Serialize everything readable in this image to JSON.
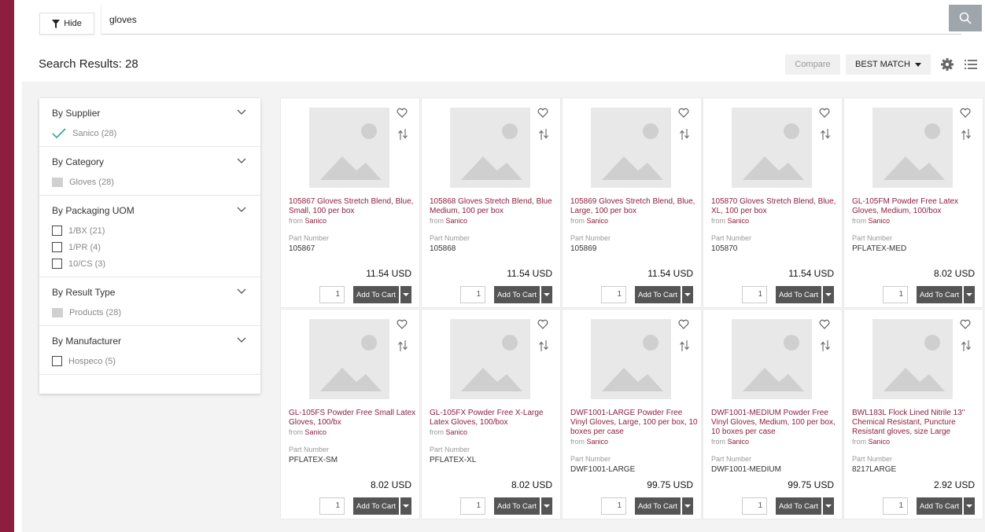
{
  "search": {
    "hide_label": "Hide",
    "value": "gloves"
  },
  "results": {
    "title": "Search Results: 28",
    "compare_label": "Compare",
    "sort_label": "BEST MATCH"
  },
  "filters": [
    {
      "title": "By Supplier",
      "options": [
        {
          "label": "Sanico (28)",
          "type": "check"
        }
      ]
    },
    {
      "title": "By Category",
      "options": [
        {
          "label": "Gloves (28)",
          "type": "gray"
        }
      ]
    },
    {
      "title": "By Packaging UOM",
      "options": [
        {
          "label": "1/BX (21)",
          "type": "box"
        },
        {
          "label": "1/PR (4)",
          "type": "box"
        },
        {
          "label": "10/CS (3)",
          "type": "box"
        }
      ]
    },
    {
      "title": "By Result Type",
      "options": [
        {
          "label": "Products (28)",
          "type": "gray"
        }
      ]
    },
    {
      "title": "By Manufacturer",
      "options": [
        {
          "label": "Hospeco (5)",
          "type": "box"
        }
      ]
    }
  ],
  "product_common": {
    "from_prefix": "from",
    "supplier": "Sanico",
    "part_label": "Part Number",
    "qty": "1",
    "add_label": "Add To Cart"
  },
  "products": [
    {
      "name": "105867 Gloves Stretch Blend, Blue, Small, 100 per box",
      "part": "105867",
      "price": "11.54  USD"
    },
    {
      "name": "105868 Gloves Stretch Blend, Blue Medium, 100 per box",
      "part": "105868",
      "price": "11.54  USD"
    },
    {
      "name": "105869 Gloves Stretch Blend, Blue, Large, 100 per box",
      "part": "105869",
      "price": "11.54  USD"
    },
    {
      "name": "105870 Gloves Stretch Blend, Blue, XL, 100 per box",
      "part": "105870",
      "price": "11.54  USD"
    },
    {
      "name": "GL-105FM Powder Free Latex Gloves, Medium, 100/box",
      "part": "PFLATEX-MED",
      "price": "8.02  USD"
    },
    {
      "name": "GL-105FS Powder Free Small Latex Gloves, 100/bx",
      "part": "PFLATEX-SM",
      "price": "8.02  USD"
    },
    {
      "name": "GL-105FX Powder Free X-Large Latex Gloves, 100/box",
      "part": "PFLATEX-XL",
      "price": "8.02  USD"
    },
    {
      "name": "DWF1001-LARGE Powder Free Vinyl Gloves, Large, 100 per box, 10 boxes per case",
      "part": "DWF1001-LARGE",
      "price": "99.75  USD"
    },
    {
      "name": "DWF1001-MEDIUM Powder Free Vinyl Gloves, Medium, 100 per box, 10 boxes per case",
      "part": "DWF1001-MEDIUM",
      "price": "99.75  USD"
    },
    {
      "name": "BWL183L Flock Lined Nitrile 13\" Chemical Resistant, Puncture Resistant gloves, size Large",
      "part": "8217LARGE",
      "price": "2.92  USD"
    }
  ],
  "colors": {
    "accent": "#8e1e3f",
    "check": "#2aa7a0",
    "button": "#555555"
  }
}
